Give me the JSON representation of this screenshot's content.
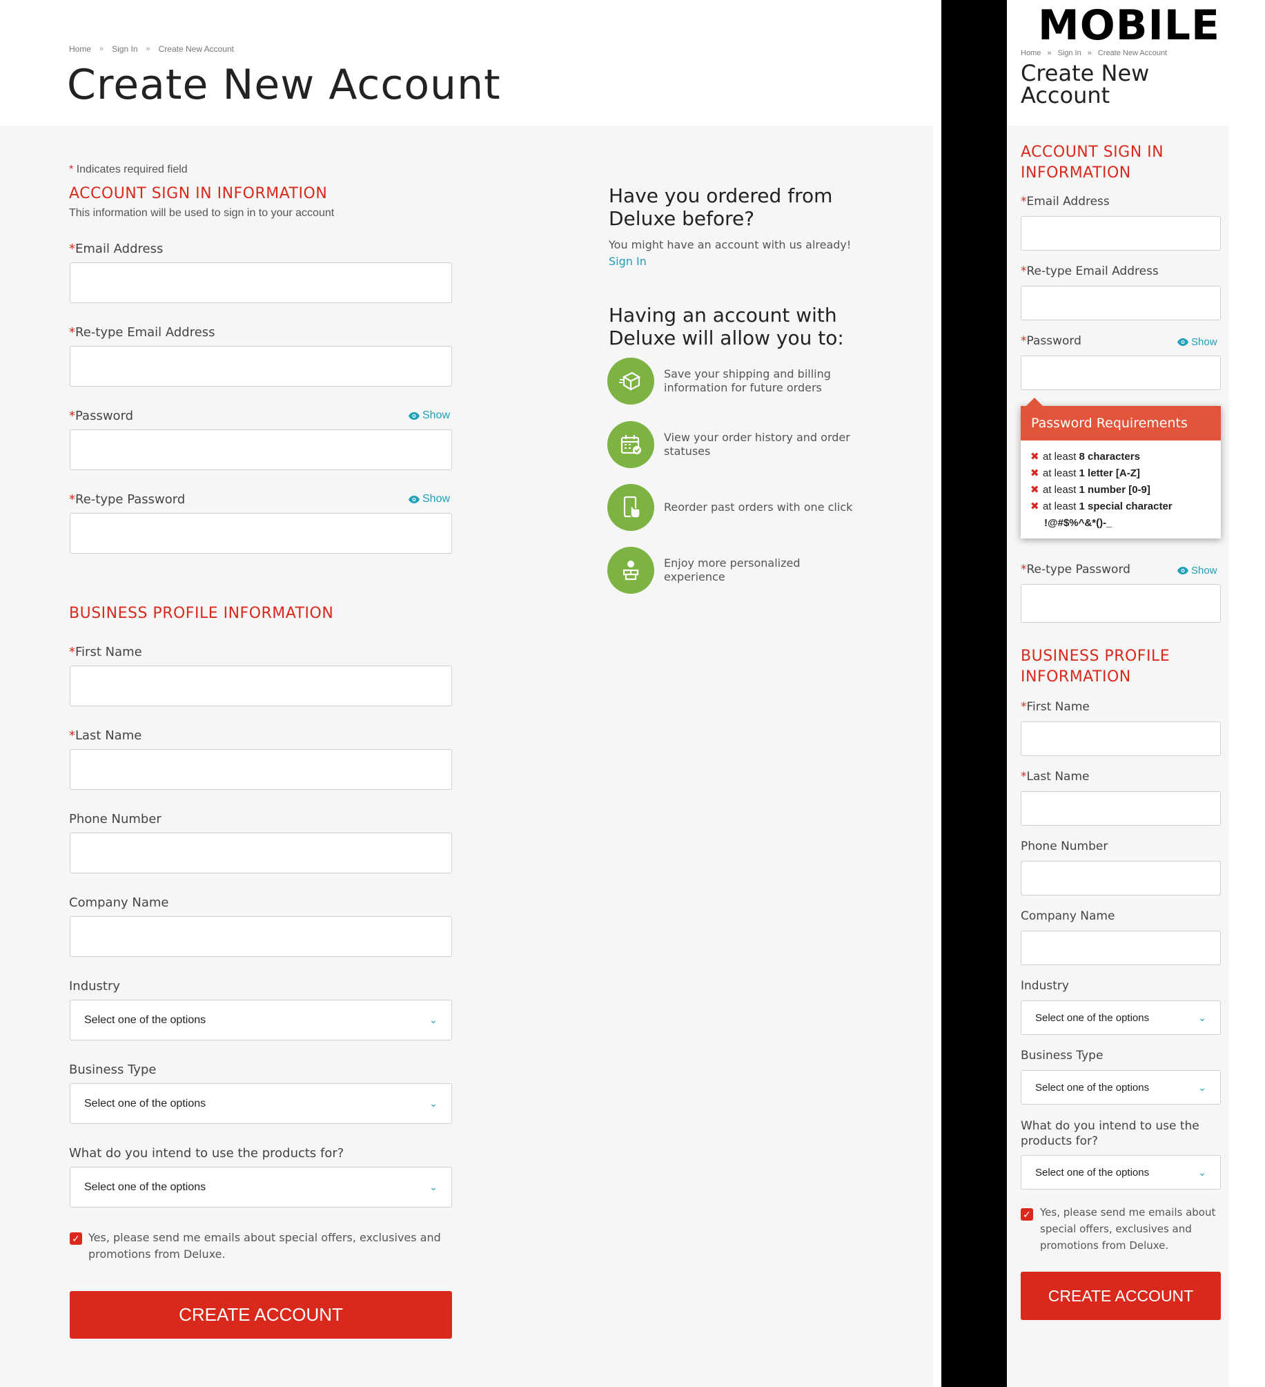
{
  "breadcrumb": [
    "Home",
    "Sign In",
    "Create New Account"
  ],
  "breadcrumb_sep": "»",
  "page_title": "Create New Account",
  "required_note": "Indicates required field",
  "required_star": "*",
  "sign_in_section": {
    "title": "ACCOUNT SIGN IN INFORMATION",
    "subtitle": "This information will be used to sign in to your account",
    "email_label": "Email Address",
    "retype_email_label": "Re-type Email Address",
    "password_label": "Password",
    "retype_password_label": "Re-type Password",
    "show_label": "Show"
  },
  "business_section": {
    "title": "BUSINESS PROFILE INFORMATION",
    "first_name_label": "First Name",
    "last_name_label": "Last Name",
    "phone_label": "Phone Number",
    "company_label": "Company Name",
    "industry_label": "Industry",
    "business_type_label": "Business Type",
    "intended_use_label": "What do you intend to use the products for?",
    "select_placeholder": "Select one of the options"
  },
  "newsletter": {
    "checked": true,
    "label": "Yes, please send me emails about special offers, exclusives and promotions from Deluxe."
  },
  "create_button": "CREATE ACCOUNT",
  "sidebar": {
    "ordered_heading": "Have you ordered from Deluxe before?",
    "ordered_text": "You might have an account with us already!",
    "sign_in_link": "Sign In",
    "benefits_heading": "Having an account with Deluxe will allow you to:",
    "benefits": [
      {
        "icon": "box-icon",
        "text": "Save your shipping and billing information for future orders"
      },
      {
        "icon": "calendar-check-icon",
        "text": "View your order history and order statuses"
      },
      {
        "icon": "phone-tap-icon",
        "text": "Reorder past orders with one click"
      },
      {
        "icon": "person-icon",
        "text": "Enjoy more personalized experience"
      }
    ],
    "icon_color": "#7cb342"
  },
  "mobile": {
    "label": "MOBILE",
    "title": "Create New Account",
    "sign_in_title": "ACCOUNT SIGN IN INFORMATION",
    "business_title": "BUSINESS PROFILE INFORMATION",
    "password_requirements": {
      "title": "Password Requirements",
      "items": [
        {
          "prefix": "at least ",
          "bold": "8 characters"
        },
        {
          "prefix": "at least ",
          "bold": "1 letter [A-Z]"
        },
        {
          "prefix": "at least ",
          "bold": "1 number [0-9]"
        },
        {
          "prefix": "at least ",
          "bold": "1 special character"
        }
      ],
      "special_chars": "!@#$%^&*()-_"
    }
  },
  "colors": {
    "accent_red": "#d9291c",
    "link_teal": "#1ea0b8",
    "tooltip_header": "#e2553a"
  }
}
